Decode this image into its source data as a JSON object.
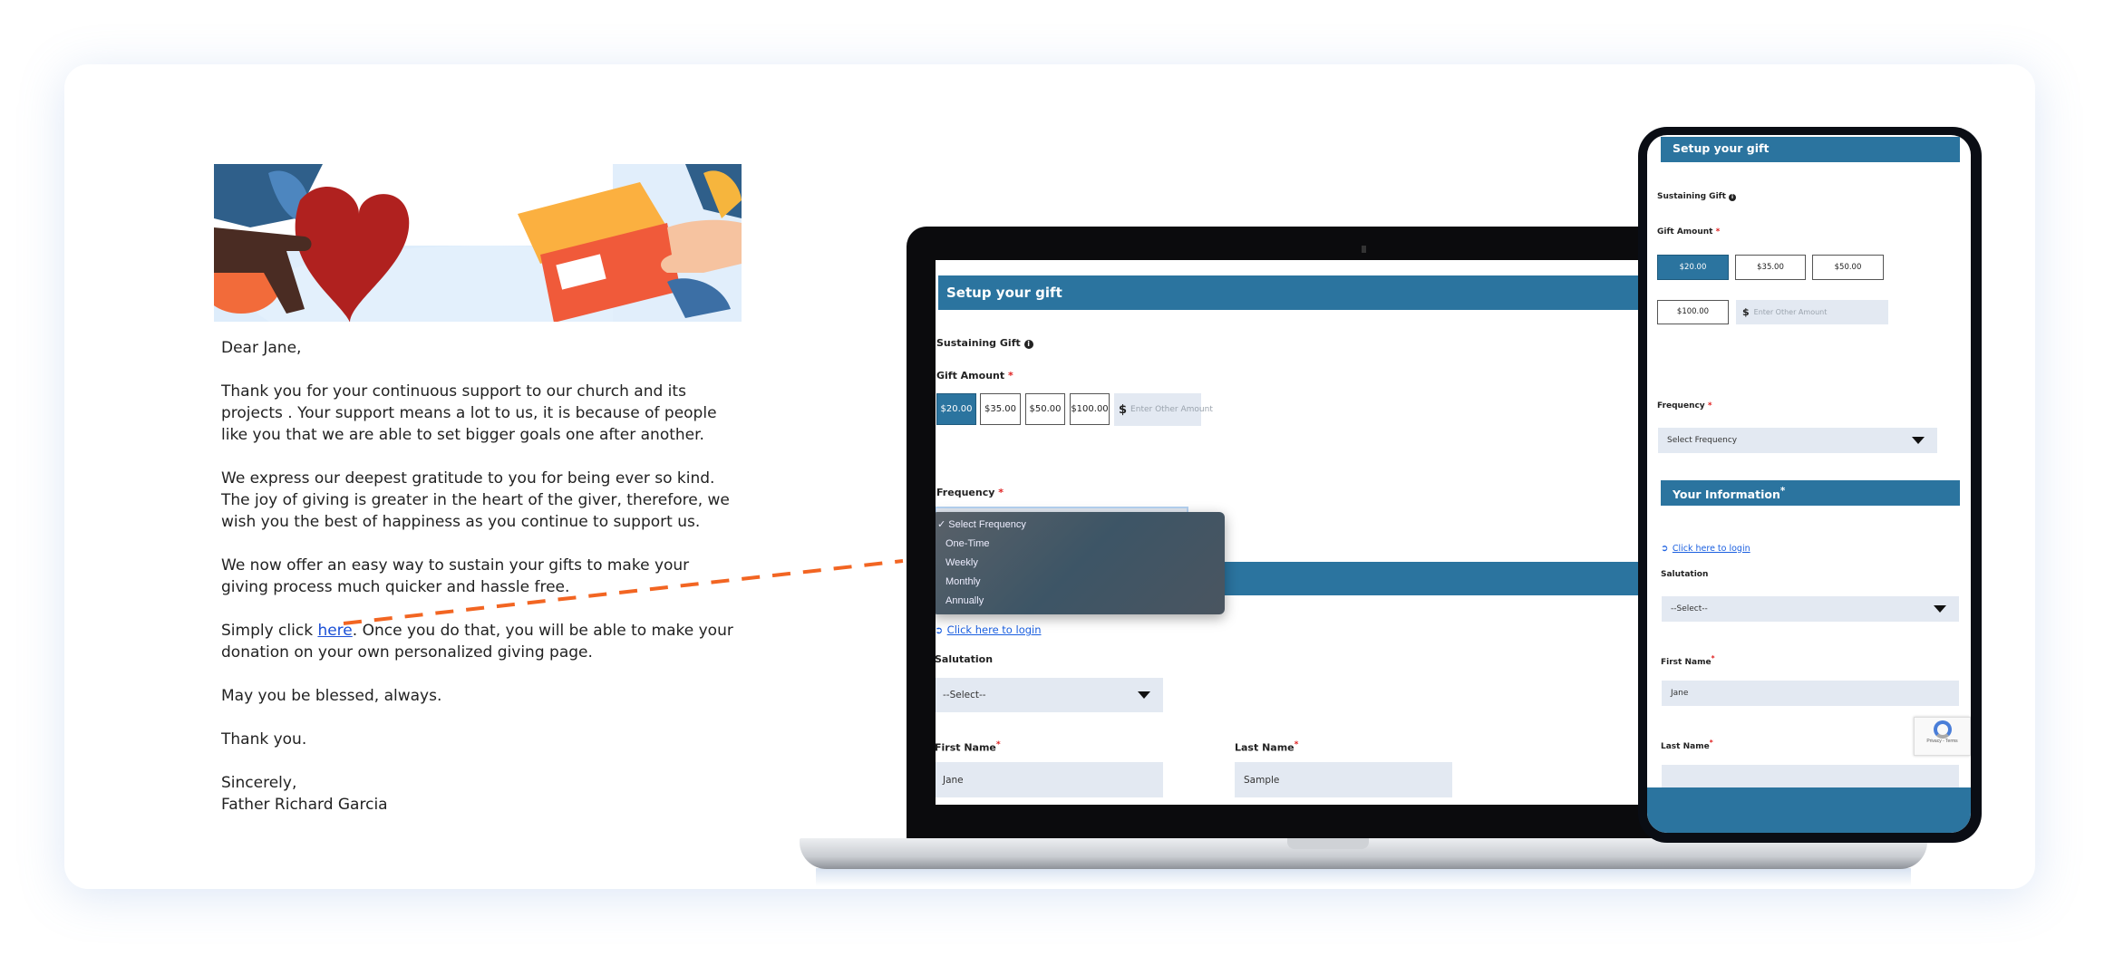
{
  "colors": {
    "brand_blue": "#2b749f",
    "dash_orange": "#f26522",
    "link_blue": "#1a5fe0",
    "field_bg": "#e3e9f2"
  },
  "letter": {
    "greeting": "Dear Jane,",
    "p1": [
      "Thank you for your continuous support to our church and its",
      "projects . Your support means a lot to us, it is because of people",
      "like you that we are able to set bigger goals one after another."
    ],
    "p2": [
      "We express our deepest gratitude to you for being ever so kind.",
      "The joy of giving is greater in the heart of the giver, therefore, we",
      "wish you the best of happiness as you continue to support us."
    ],
    "p3": [
      "We now offer an easy way to sustain your gifts to make your",
      "giving process much quicker and hassle free."
    ],
    "p4_prefix": "Simply click ",
    "p4_link": "here",
    "p4_suffix": ". Once you do that, you will be able to make your",
    "p4_line2": "donation on your own personalized giving page.",
    "blessing": "May you be blessed, always.",
    "thanks": "Thank you.",
    "closing": "Sincerely,",
    "signature": "Father Richard Garcia"
  },
  "laptop": {
    "setup_title": "Setup your gift",
    "sustaining_label": "Sustaining Gift",
    "gift_amount_label": "Gift Amount",
    "amounts": [
      "$20.00",
      "$35.00",
      "$50.00",
      "$100.00"
    ],
    "selected_amount": "$20.00",
    "other_amount_placeholder": "Enter Other Amount",
    "currency_symbol": "$",
    "frequency_label": "Frequency",
    "frequency_options": [
      "Select Frequency",
      "One-Time",
      "Weekly",
      "Monthly",
      "Annually"
    ],
    "frequency_checked": "✓",
    "login_link": "Click here to login",
    "salutation_label": "Salutation",
    "salutation_value": "--Select--",
    "first_name_label": "First Name",
    "first_name_value": "Jane",
    "last_name_label": "Last Name",
    "last_name_value": "Sample",
    "required_mark": "*"
  },
  "phone": {
    "setup_title": "Setup your gift",
    "sustaining_label": "Sustaining Gift",
    "gift_amount_label": "Gift Amount",
    "amounts": [
      "$20.00",
      "$35.00",
      "$50.00",
      "$100.00"
    ],
    "other_amount_placeholder": "Enter Other Amount",
    "currency_symbol": "$",
    "frequency_label": "Frequency",
    "frequency_value": "Select Frequency",
    "info_title": "Your Information",
    "login_link": "Click here to login",
    "salutation_label": "Salutation",
    "salutation_value": "--Select--",
    "first_name_label": "First Name",
    "first_name_value": "Jane",
    "last_name_label": "Last Name",
    "recaptcha_text": "Privacy - Terms",
    "required_mark": "*"
  }
}
